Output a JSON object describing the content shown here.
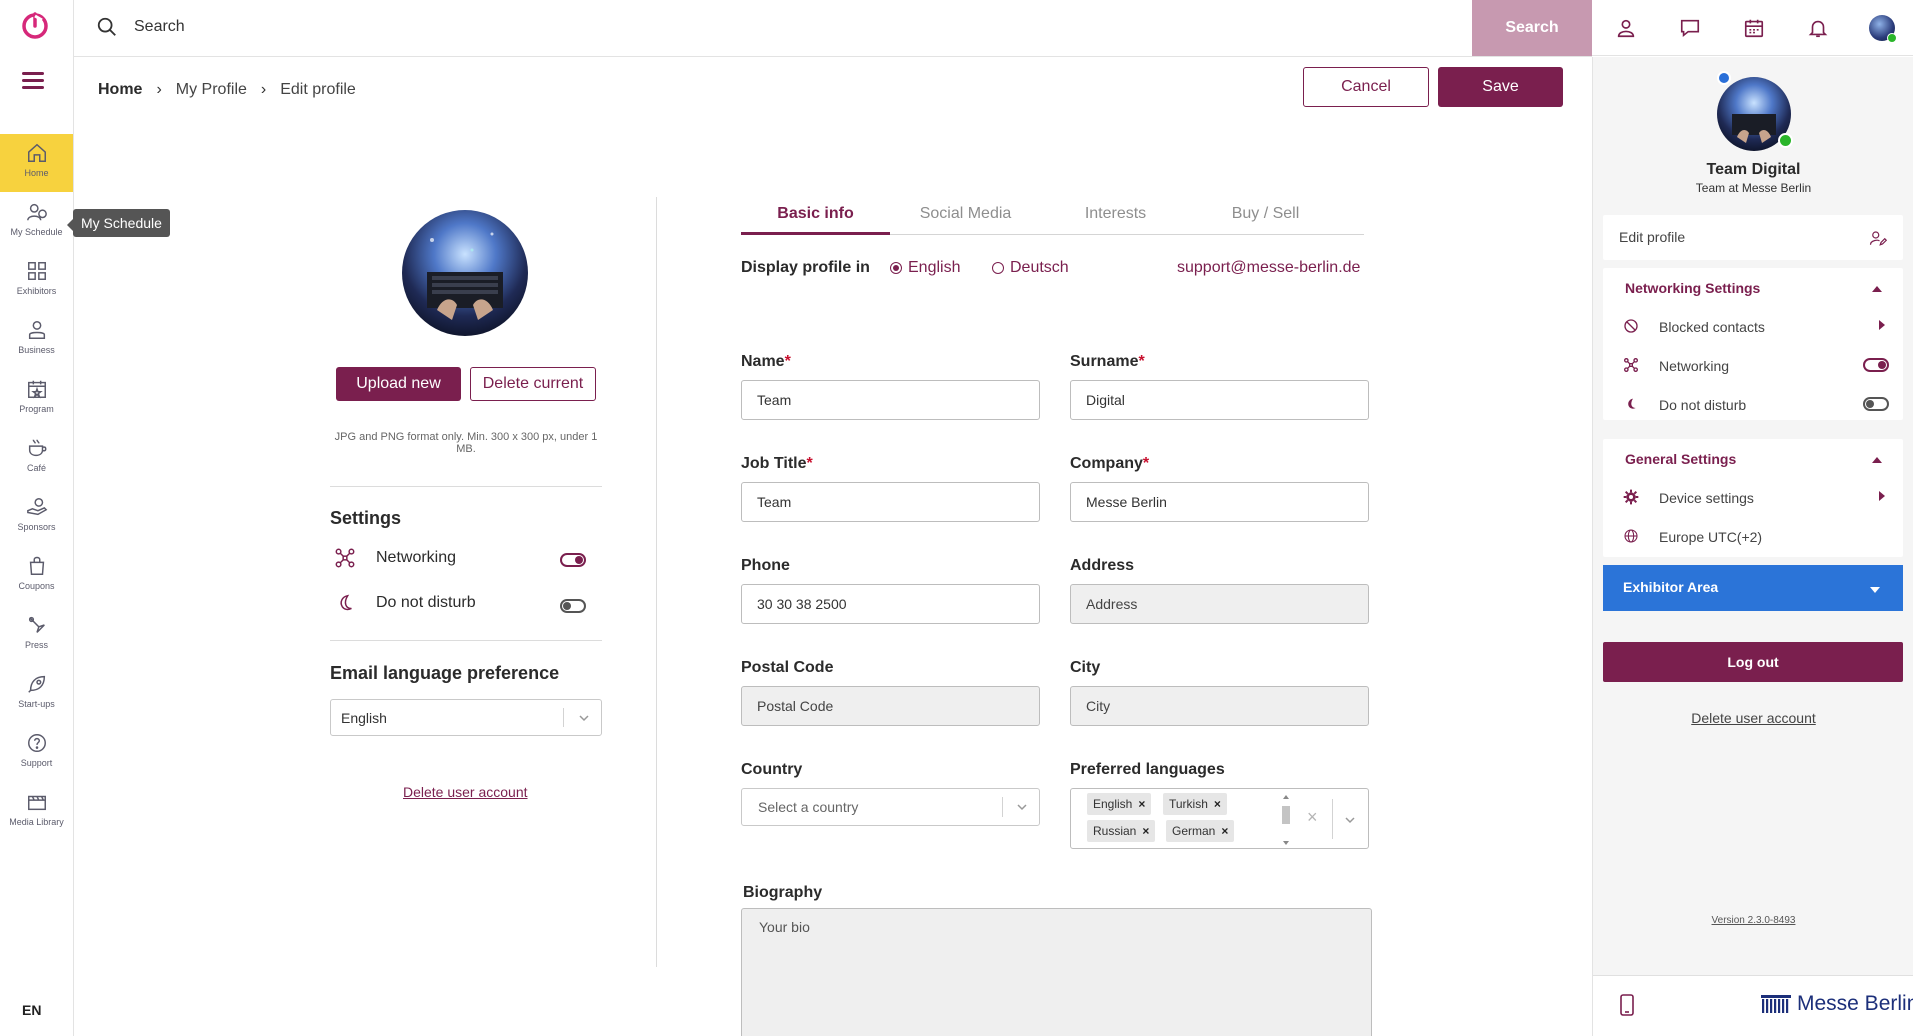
{
  "topbar": {
    "search_placeholder": "Search",
    "search_button": "Search"
  },
  "leftnav": {
    "items": [
      {
        "label": "Home",
        "icon": "home-icon"
      },
      {
        "label": "My Schedule",
        "icon": "schedule-icon"
      },
      {
        "label": "Exhibitors",
        "icon": "exhibitors-icon"
      },
      {
        "label": "Business",
        "icon": "business-icon"
      },
      {
        "label": "Program",
        "icon": "program-icon"
      },
      {
        "label": "Café",
        "icon": "cafe-icon"
      },
      {
        "label": "Sponsors",
        "icon": "sponsors-icon"
      },
      {
        "label": "Coupons",
        "icon": "coupons-icon"
      },
      {
        "label": "Press",
        "icon": "press-icon"
      },
      {
        "label": "Start-ups",
        "icon": "startups-icon"
      },
      {
        "label": "Support",
        "icon": "support-icon"
      },
      {
        "label": "Media Library",
        "icon": "media-library-icon"
      }
    ],
    "tooltip": "My Schedule",
    "language": "EN"
  },
  "breadcrumb": {
    "home": "Home",
    "profile": "My Profile",
    "current": "Edit profile"
  },
  "actions": {
    "cancel": "Cancel",
    "save": "Save"
  },
  "photo": {
    "upload": "Upload new",
    "delete": "Delete current",
    "hint": "JPG and PNG format only. Min. 300 x 300 px, under 1 MB."
  },
  "settings": {
    "title": "Settings",
    "networking": "Networking",
    "networking_on": true,
    "dnd": "Do not disturb",
    "dnd_on": false
  },
  "email_pref": {
    "title": "Email language preference",
    "value": "English"
  },
  "delete_account": "Delete user account",
  "tabs": [
    "Basic info",
    "Social Media",
    "Interests",
    "Buy / Sell"
  ],
  "display": {
    "label": "Display profile in",
    "options": [
      "English",
      "Deutsch"
    ],
    "selected": "English",
    "support_email": "support@messe-berlin.de"
  },
  "form": {
    "name_label": "Name",
    "name_value": "Team",
    "surname_label": "Surname",
    "surname_value": "Digital",
    "jobtitle_label": "Job Title",
    "jobtitle_value": "Team",
    "company_label": "Company",
    "company_value": "Messe Berlin",
    "phone_label": "Phone",
    "phone_value": "30 30 38 2500",
    "address_label": "Address",
    "address_placeholder": "Address",
    "postal_label": "Postal Code",
    "postal_placeholder": "Postal Code",
    "city_label": "City",
    "city_placeholder": "City",
    "country_label": "Country",
    "country_placeholder": "Select a country",
    "languages_label": "Preferred languages",
    "languages": [
      "English",
      "Turkish",
      "Russian",
      "German"
    ],
    "bio_label": "Biography",
    "bio_placeholder": "Your bio",
    "required_mark": "*"
  },
  "right_panel": {
    "name": "Team Digital",
    "role": "Team at Messe Berlin",
    "edit_profile": "Edit profile",
    "networking_settings": "Networking Settings",
    "blocked_contacts": "Blocked contacts",
    "networking": "Networking",
    "do_not_disturb": "Do not disturb",
    "general_settings": "General Settings",
    "device_settings": "Device settings",
    "timezone": "Europe UTC(+2)",
    "exhibitor_area": "Exhibitor Area",
    "logout": "Log out",
    "delete_account": "Delete user account",
    "version": "Version 2.3.0-8493",
    "brand": "Messe Berlin"
  },
  "colors": {
    "primary": "#7a1f4e",
    "accent_nav": "#f7d23e",
    "search_button": "#c799b0",
    "exhibitor_blue": "#2b74d8",
    "online": "#2ab52a"
  }
}
